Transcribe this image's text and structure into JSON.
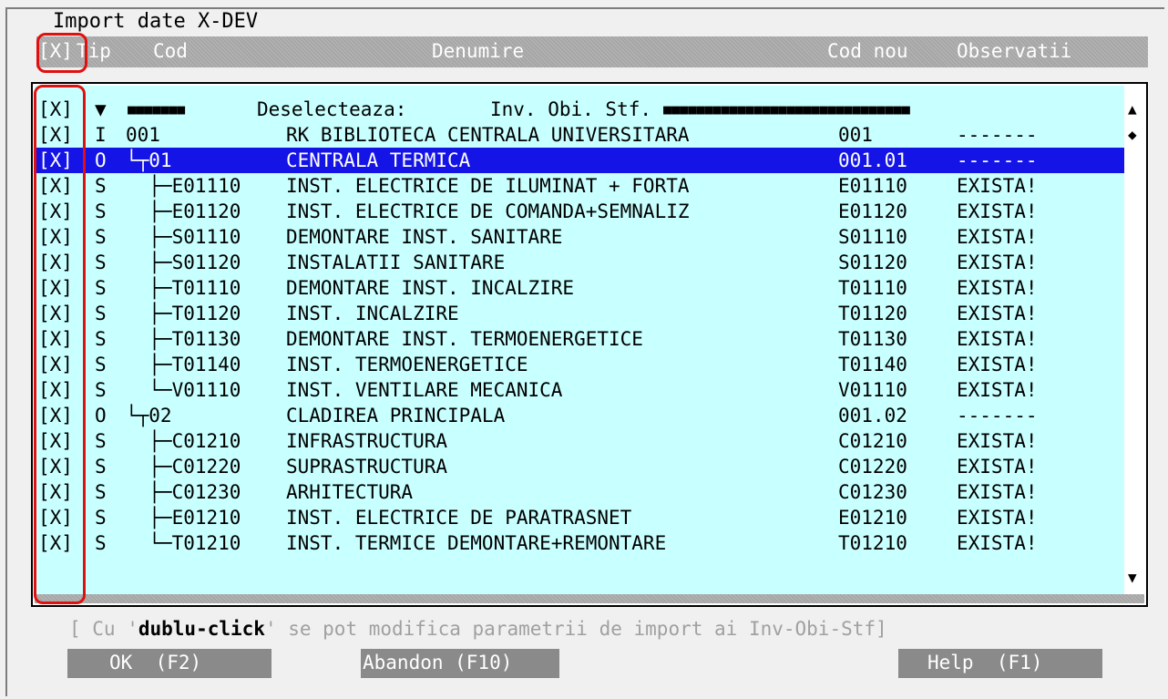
{
  "title": "Import date X-DEV",
  "header": {
    "select_all": "[X]",
    "col_tip": "Tip",
    "col_cod": "Cod",
    "col_denumire": "Denumire",
    "col_cod_nou": "Cod nou",
    "col_observatii": "Observatii"
  },
  "filter_row": {
    "check": "[X]",
    "arrow": "▼",
    "blocks_left": "■■■■■■■",
    "label": "Deselecteaza:",
    "options": "Inv. Obi. Stf.",
    "blocks_right": "■■■■■■■■■■■■■■■■■■■■■■■■■■■■■■"
  },
  "rows": [
    {
      "check": "[X]",
      "tip": "I",
      "cod": "001",
      "denumire": "RK BIBLIOTECA CENTRALA UNIVERSITARA",
      "cod_nou": "001",
      "obs": "-------"
    },
    {
      "check": "[X]",
      "tip": "O",
      "cod": "└┬01",
      "denumire": "CENTRALA TERMICA",
      "cod_nou": "001.01",
      "obs": "-------"
    },
    {
      "check": "[X]",
      "tip": "S",
      "cod": "  ├─E01110",
      "denumire": "INST. ELECTRICE DE ILUMINAT + FORTA",
      "cod_nou": "E01110",
      "obs": "EXISTA!"
    },
    {
      "check": "[X]",
      "tip": "S",
      "cod": "  ├─E01120",
      "denumire": "INST. ELECTRICE DE COMANDA+SEMNALIZ",
      "cod_nou": "E01120",
      "obs": "EXISTA!"
    },
    {
      "check": "[X]",
      "tip": "S",
      "cod": "  ├─S01110",
      "denumire": "DEMONTARE INST. SANITARE",
      "cod_nou": "S01110",
      "obs": "EXISTA!"
    },
    {
      "check": "[X]",
      "tip": "S",
      "cod": "  ├─S01120",
      "denumire": "INSTALATII SANITARE",
      "cod_nou": "S01120",
      "obs": "EXISTA!"
    },
    {
      "check": "[X]",
      "tip": "S",
      "cod": "  ├─T01110",
      "denumire": "DEMONTARE INST. INCALZIRE",
      "cod_nou": "T01110",
      "obs": "EXISTA!"
    },
    {
      "check": "[X]",
      "tip": "S",
      "cod": "  ├─T01120",
      "denumire": "INST. INCALZIRE",
      "cod_nou": "T01120",
      "obs": "EXISTA!"
    },
    {
      "check": "[X]",
      "tip": "S",
      "cod": "  ├─T01130",
      "denumire": "DEMONTARE INST. TERMOENERGETICE",
      "cod_nou": "T01130",
      "obs": "EXISTA!"
    },
    {
      "check": "[X]",
      "tip": "S",
      "cod": "  ├─T01140",
      "denumire": "INST. TERMOENERGETICE",
      "cod_nou": "T01140",
      "obs": "EXISTA!"
    },
    {
      "check": "[X]",
      "tip": "S",
      "cod": "  └─V01110",
      "denumire": "INST. VENTILARE MECANICA",
      "cod_nou": "V01110",
      "obs": "EXISTA!"
    },
    {
      "check": "[X]",
      "tip": "O",
      "cod": "└┬02",
      "denumire": "CLADIREA PRINCIPALA",
      "cod_nou": "001.02",
      "obs": "-------"
    },
    {
      "check": "[X]",
      "tip": "S",
      "cod": "  ├─C01210",
      "denumire": "INFRASTRUCTURA",
      "cod_nou": "C01210",
      "obs": "EXISTA!"
    },
    {
      "check": "[X]",
      "tip": "S",
      "cod": "  ├─C01220",
      "denumire": "SUPRASTRUCTURA",
      "cod_nou": "C01220",
      "obs": "EXISTA!"
    },
    {
      "check": "[X]",
      "tip": "S",
      "cod": "  ├─C01230",
      "denumire": "ARHITECTURA",
      "cod_nou": "C01230",
      "obs": "EXISTA!"
    },
    {
      "check": "[X]",
      "tip": "S",
      "cod": "  ├─E01210",
      "denumire": "INST. ELECTRICE DE PARATRASNET",
      "cod_nou": "E01210",
      "obs": "EXISTA!"
    },
    {
      "check": "[X]",
      "tip": "S",
      "cod": "  └─T01210",
      "denumire": "INST. TERMICE DEMONTARE+REMONTARE",
      "cod_nou": "T01210",
      "obs": "EXISTA!"
    }
  ],
  "selected_row": 1,
  "hint": {
    "pre": "[ Cu '",
    "bold": "dublu-click",
    "post": "' se pot modifica parametrii de import ai Inv-Obi-Stf]"
  },
  "buttons": {
    "ok": "OK  (F2)",
    "abandon": "Abandon (F10)",
    "help": "Help  (F1)"
  },
  "scroll": {
    "up_icon": "arrow-up-icon",
    "thumb_icon": "scroll-thumb-icon",
    "down_icon": "arrow-down-icon"
  },
  "colors": {
    "list_bg": "#c8ffff",
    "selected_bg": "#1414e6",
    "header_bg": "#a6a6a6",
    "annotation": "#e01010"
  }
}
